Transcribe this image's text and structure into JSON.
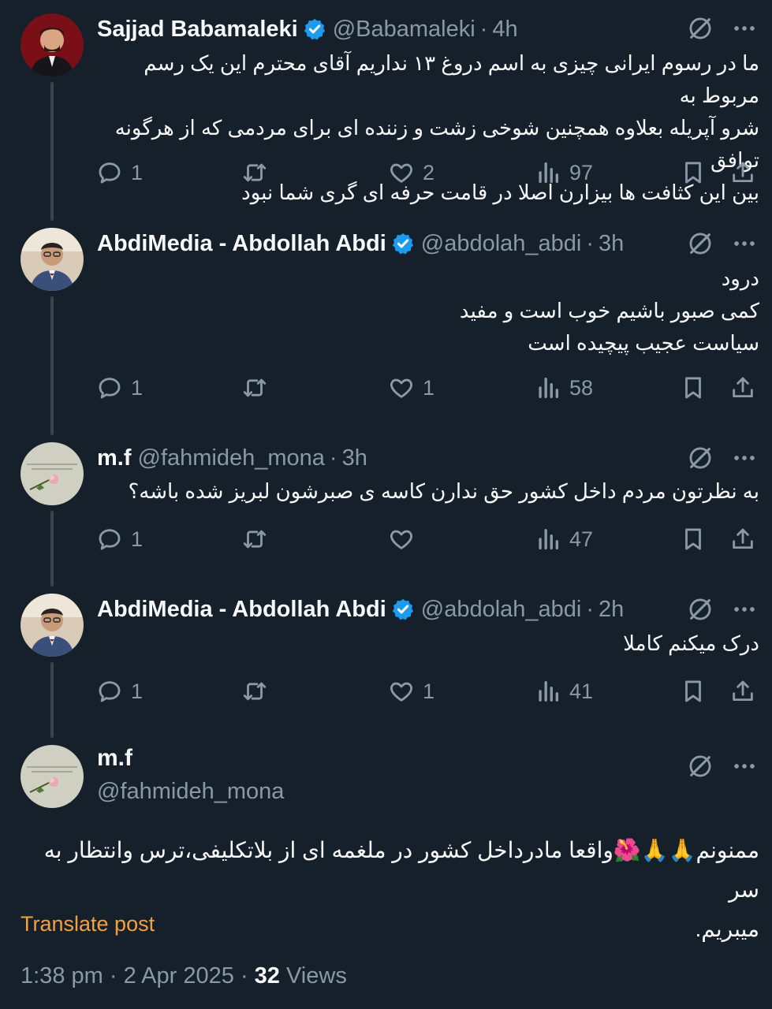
{
  "tweets": [
    {
      "name": "Sajjad Babamaleki",
      "verified": true,
      "handle": "@Babamaleki",
      "time": "4h",
      "lines": [
        "ما در رسوم ایرانی چیزی به اسم دروغ ۱۳ نداریم آقای محترم این یک رسم مربوط به",
        "شرو آپریله بعلاوه همچنین شوخی زشت و زننده ای برای مردمی که از هرگونه توافق",
        "بین این کثافت ها بیزارن اصلا در قامت حرفه ای گری شما نبود"
      ],
      "replies": "1",
      "retweets": "",
      "likes": "2",
      "views": "97"
    },
    {
      "name": "AbdiMedia - Abdollah Abdi",
      "verified": true,
      "handle": "@abdolah_abdi",
      "time": "3h",
      "lines": [
        "درود",
        "کمی صبور باشیم خوب است و مفید",
        "سیاست عجیب پیچیده است"
      ],
      "replies": "1",
      "retweets": "",
      "likes": "1",
      "views": "58"
    },
    {
      "name": "m.f",
      "verified": false,
      "handle": "@fahmideh_mona",
      "time": "3h",
      "lines": [
        "به نظرتون مردم داخل کشور حق ندارن کاسه ی صبرشون لبریز شده باشه؟"
      ],
      "replies": "1",
      "retweets": "",
      "likes": "",
      "views": "47"
    },
    {
      "name": "AbdiMedia - Abdollah Abdi",
      "verified": true,
      "handle": "@abdolah_abdi",
      "time": "2h",
      "lines": [
        "درک میکنم کاملا"
      ],
      "replies": "1",
      "retweets": "",
      "likes": "1",
      "views": "41"
    }
  ],
  "focused": {
    "name": "m.f",
    "handle": "@fahmideh_mona",
    "lines": [
      "ممنونم🙏🙏🌺واقعا مادرداخل کشور در ملغمه ای از بلاتکلیفی،ترس وانتظار به سر",
      "میبریم."
    ],
    "translate_label": "Translate post",
    "time": "1:38 pm",
    "date": "2 Apr 2025",
    "views_count": "32",
    "views_label": "Views"
  },
  "colors": {
    "background": "#15202b",
    "text": "#f7f9f9",
    "muted": "#8b98a5",
    "verified": "#1d9bf0",
    "translate": "#f4a03c"
  },
  "icons": [
    "verified-badge-icon",
    "grok-icon",
    "more-icon",
    "reply-icon",
    "retweet-icon",
    "like-icon",
    "views-icon",
    "bookmark-icon",
    "share-icon"
  ]
}
